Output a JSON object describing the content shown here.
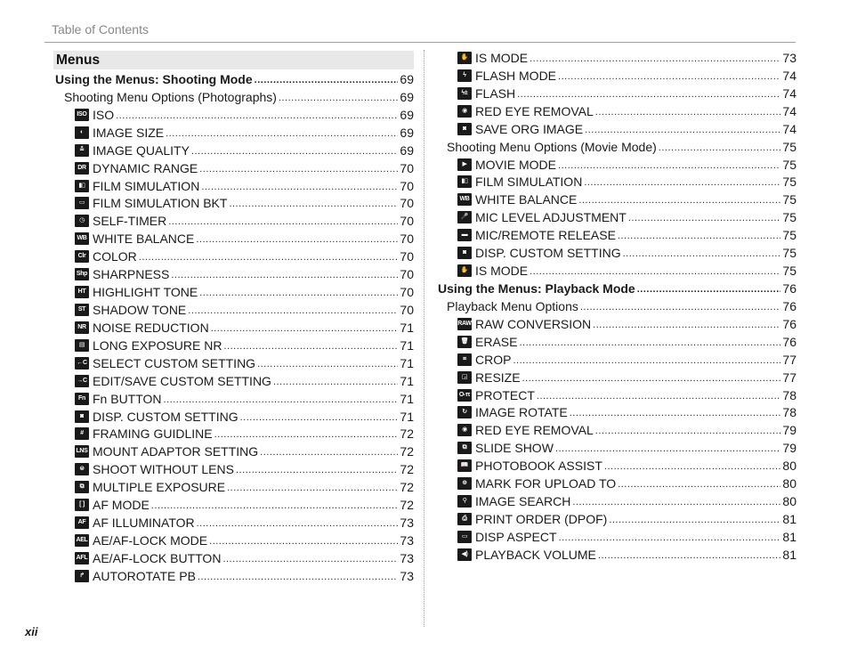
{
  "header": {
    "title": "Table of Contents"
  },
  "footer": {
    "page_number": "xii"
  },
  "section": {
    "title": "Menus"
  },
  "left_column": [
    {
      "level": 1,
      "label": "Using the Menus: Shooting Mode",
      "page": "69"
    },
    {
      "level": 2,
      "label": "Shooting Menu Options (Photographs)",
      "page": "69"
    },
    {
      "level": 3,
      "icon": "iso-icon",
      "glyph": "ISO",
      "label": "ISO",
      "page": "69"
    },
    {
      "level": 3,
      "icon": "image-size-icon",
      "glyph": "◐",
      "label": "IMAGE SIZE",
      "page": "69"
    },
    {
      "level": 3,
      "icon": "image-quality-icon",
      "glyph": "≛",
      "label": "IMAGE QUALITY",
      "page": "69"
    },
    {
      "level": 3,
      "icon": "dynamic-range-icon",
      "glyph": "DR",
      "label": "DYNAMIC RANGE",
      "page": "70"
    },
    {
      "level": 3,
      "icon": "film-simulation-icon",
      "glyph": "▮▯",
      "label": "FILM SIMULATION",
      "page": "70"
    },
    {
      "level": 3,
      "icon": "film-simulation-bkt-icon",
      "glyph": "▭",
      "label": "FILM SIMULATION BKT",
      "page": "70"
    },
    {
      "level": 3,
      "icon": "self-timer-icon",
      "glyph": "◷",
      "label": "SELF-TIMER",
      "page": "70"
    },
    {
      "level": 3,
      "icon": "white-balance-icon",
      "glyph": "WB",
      "label": "WHITE BALANCE",
      "page": "70"
    },
    {
      "level": 3,
      "icon": "color-icon",
      "glyph": "Clr",
      "label": "COLOR",
      "page": "70"
    },
    {
      "level": 3,
      "icon": "sharpness-icon",
      "glyph": "Shp",
      "label": "SHARPNESS",
      "page": "70"
    },
    {
      "level": 3,
      "icon": "highlight-tone-icon",
      "glyph": "HT",
      "label": "HIGHLIGHT TONE",
      "page": "70"
    },
    {
      "level": 3,
      "icon": "shadow-tone-icon",
      "glyph": "ST",
      "label": "SHADOW TONE",
      "page": "70"
    },
    {
      "level": 3,
      "icon": "noise-reduction-icon",
      "glyph": "NR",
      "label": "NOISE REDUCTION",
      "page": "71"
    },
    {
      "level": 3,
      "icon": "long-exposure-nr-icon",
      "glyph": "▤",
      "label": "LONG EXPOSURE NR",
      "page": "71"
    },
    {
      "level": 3,
      "icon": "select-custom-setting-icon",
      "glyph": "←C",
      "label": "SELECT CUSTOM SETTING",
      "page": "71"
    },
    {
      "level": 3,
      "icon": "edit-save-custom-setting-icon",
      "glyph": "→C",
      "label": "EDIT/SAVE CUSTOM SETTING",
      "page": "71"
    },
    {
      "level": 3,
      "icon": "fn-button-icon",
      "glyph": "Fn",
      "label": "Fn BUTTON",
      "page": "71"
    },
    {
      "level": 3,
      "icon": "disp-custom-setting-icon",
      "glyph": "◙",
      "label": "DISP. CUSTOM SETTING",
      "page": "71"
    },
    {
      "level": 3,
      "icon": "framing-guideline-icon",
      "glyph": "#",
      "label": "FRAMING GUIDLINE",
      "page": "72"
    },
    {
      "level": 3,
      "icon": "mount-adaptor-setting-icon",
      "glyph": "LNS",
      "label": "MOUNT ADAPTOR SETTING",
      "page": "72"
    },
    {
      "level": 3,
      "icon": "shoot-without-lens-icon",
      "glyph": "⊜",
      "label": "SHOOT WITHOUT LENS",
      "page": "72"
    },
    {
      "level": 3,
      "icon": "multiple-exposure-icon",
      "glyph": "⧉",
      "label": "MULTIPLE EXPOSURE",
      "page": "72"
    },
    {
      "level": 3,
      "icon": "af-mode-icon",
      "glyph": "[ ]",
      "label": "AF MODE",
      "page": "72"
    },
    {
      "level": 3,
      "icon": "af-illuminator-icon",
      "glyph": "AF",
      "label": "AF ILLUMINATOR",
      "page": "73"
    },
    {
      "level": 3,
      "icon": "ae-af-lock-mode-icon",
      "glyph": "AEL",
      "label": "AE/AF-LOCK MODE",
      "page": "73"
    },
    {
      "level": 3,
      "icon": "ae-af-lock-button-icon",
      "glyph": "AFL",
      "label": "AE/AF-LOCK BUTTON",
      "page": "73"
    },
    {
      "level": 3,
      "icon": "autorotate-pb-icon",
      "glyph": "↱",
      "label": "AUTOROTATE PB",
      "page": "73"
    }
  ],
  "right_column": [
    {
      "level": 3,
      "icon": "is-mode-icon",
      "glyph": "✋",
      "label": "IS MODE",
      "page": "73"
    },
    {
      "level": 3,
      "icon": "flash-mode-icon",
      "glyph": "ϟ",
      "label": "FLASH MODE",
      "page": "74"
    },
    {
      "level": 3,
      "icon": "flash-icon",
      "glyph": "ϟ±",
      "label": "FLASH",
      "page": "74"
    },
    {
      "level": 3,
      "icon": "red-eye-removal-icon",
      "glyph": "◉",
      "label": "RED EYE REMOVAL",
      "page": "74"
    },
    {
      "level": 3,
      "icon": "save-org-image-icon",
      "glyph": "◙",
      "label": "SAVE ORG IMAGE",
      "page": "74"
    },
    {
      "level": 2,
      "label": "Shooting Menu Options (Movie Mode)",
      "page": "75"
    },
    {
      "level": 3,
      "icon": "movie-mode-icon",
      "glyph": "▶",
      "label": "MOVIE MODE",
      "page": "75"
    },
    {
      "level": 3,
      "icon": "film-simulation-icon",
      "glyph": "▮▯",
      "label": "FILM SIMULATION",
      "page": "75"
    },
    {
      "level": 3,
      "icon": "white-balance-icon",
      "glyph": "WB",
      "label": "WHITE BALANCE",
      "page": "75"
    },
    {
      "level": 3,
      "icon": "mic-level-adjustment-icon",
      "glyph": "🎤",
      "label": "MIC LEVEL ADJUSTMENT",
      "page": "75"
    },
    {
      "level": 3,
      "icon": "mic-remote-release-icon",
      "glyph": "▬",
      "label": "MIC/REMOTE RELEASE",
      "page": "75"
    },
    {
      "level": 3,
      "icon": "disp-custom-setting-icon",
      "glyph": "◙",
      "label": "DISP. CUSTOM SETTING",
      "page": "75"
    },
    {
      "level": 3,
      "icon": "is-mode-icon",
      "glyph": "✋",
      "label": "IS MODE",
      "page": "75"
    },
    {
      "level": 1,
      "label": "Using the Menus: Playback Mode",
      "page": "76"
    },
    {
      "level": 2,
      "label": "Playback Menu Options",
      "page": "76"
    },
    {
      "level": 3,
      "icon": "raw-conversion-icon",
      "glyph": "RAW",
      "label": "RAW CONVERSION",
      "page": "76"
    },
    {
      "level": 3,
      "icon": "erase-icon",
      "glyph": "🗑",
      "label": "ERASE",
      "page": "76"
    },
    {
      "level": 3,
      "icon": "crop-icon",
      "glyph": "⌗",
      "label": "CROP",
      "page": "77"
    },
    {
      "level": 3,
      "icon": "resize-icon",
      "glyph": "◲",
      "label": "RESIZE",
      "page": "77"
    },
    {
      "level": 3,
      "icon": "protect-icon",
      "glyph": "O-π",
      "label": "PROTECT",
      "page": "78"
    },
    {
      "level": 3,
      "icon": "image-rotate-icon",
      "glyph": "↻",
      "label": "IMAGE ROTATE",
      "page": "78"
    },
    {
      "level": 3,
      "icon": "red-eye-removal-icon",
      "glyph": "◉",
      "label": "RED EYE REMOVAL",
      "page": "79"
    },
    {
      "level": 3,
      "icon": "slide-show-icon",
      "glyph": "⧉",
      "label": "SLIDE SHOW",
      "page": "79"
    },
    {
      "level": 3,
      "icon": "photobook-assist-icon",
      "glyph": "📖",
      "label": "PHOTOBOOK ASSIST",
      "page": "80"
    },
    {
      "level": 3,
      "icon": "mark-for-upload-icon",
      "glyph": "⊕",
      "label": "MARK FOR UPLOAD TO",
      "page": "80"
    },
    {
      "level": 3,
      "icon": "image-search-icon",
      "glyph": "⚲",
      "label": "IMAGE SEARCH",
      "page": "80"
    },
    {
      "level": 3,
      "icon": "print-order-icon",
      "glyph": "⎙",
      "label": "PRINT ORDER (DPOF)",
      "page": "81"
    },
    {
      "level": 3,
      "icon": "disp-aspect-icon",
      "glyph": "▭",
      "label": "DISP ASPECT",
      "page": "81"
    },
    {
      "level": 3,
      "icon": "playback-volume-icon",
      "glyph": "◀)",
      "label": "PLAYBACK VOLUME",
      "page": "81"
    }
  ]
}
